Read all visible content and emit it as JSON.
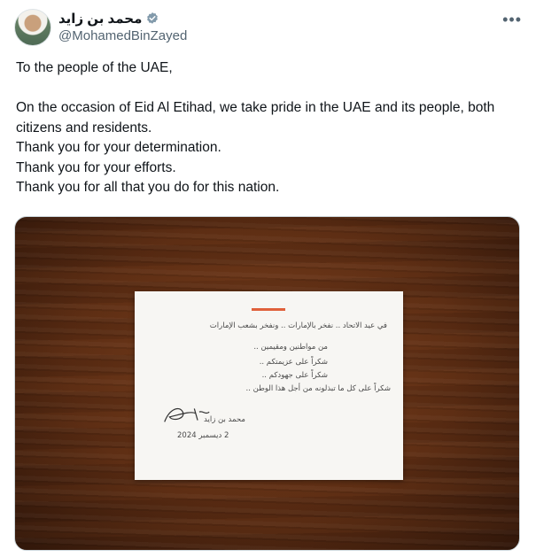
{
  "author": {
    "display_name": "محمد بن زايد",
    "handle": "@MohamedBinZayed",
    "verified": true,
    "icons": {
      "verified": "verified-badge-icon",
      "more": "more-options-icon"
    }
  },
  "tweet": {
    "greeting": "To the people of the UAE,",
    "lines": [
      "On the occasion of Eid Al Etihad, we take pride in the UAE and its people, both citizens and residents.",
      "Thank you for your determination.",
      "Thank you for your efforts.",
      "Thank you for all that you do for this nation."
    ]
  },
  "media": {
    "card_lines": [
      "في عيد الاتحاد .. نفخر بالإمارات .. ونفخر بشعب الإمارات",
      "من مواطنين ومقيمين ..",
      "شكراً على عزيمتكم ..",
      "شكراً على جهودكم ..",
      "شكراً على كل ما تبذلونه من أجل هذا الوطن .."
    ],
    "signature_name": "محمد بن زايد",
    "date": "2 ديسمبر 2024",
    "colors": {
      "accent": "#e0603b",
      "wood": "#6b3418",
      "paper": "#f7f6f3"
    }
  }
}
